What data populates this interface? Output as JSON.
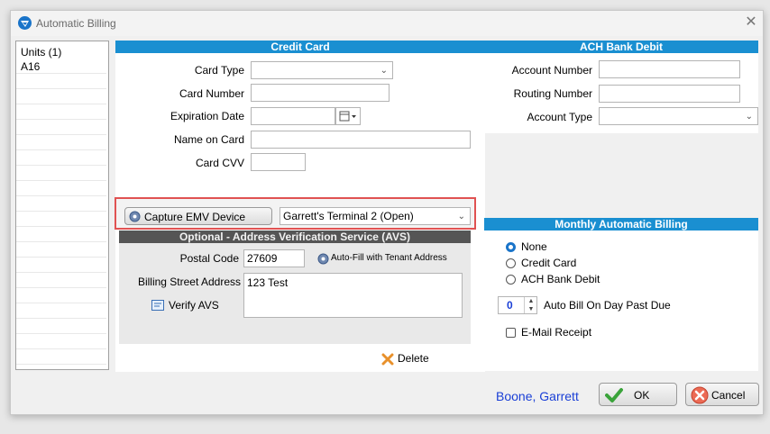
{
  "window": {
    "title": "Automatic Billing",
    "close_glyph": "✕"
  },
  "units": {
    "header": "Units (1)",
    "items": [
      "A16"
    ]
  },
  "credit_card": {
    "header": "Credit Card",
    "card_type_label": "Card Type",
    "card_type_value": "",
    "card_number_label": "Card Number",
    "card_number_value": "",
    "expiration_label": "Expiration Date",
    "expiration_value": "",
    "name_label": "Name on Card",
    "name_value": "",
    "cvv_label": "Card CVV",
    "cvv_value": ""
  },
  "emv": {
    "capture_button": "Capture EMV Device",
    "terminal_value": "Garrett's Terminal 2 (Open)"
  },
  "avs": {
    "header": "Optional - Address Verification Service (AVS)",
    "postal_label": "Postal Code",
    "postal_value": "27609",
    "autofill_button": "Auto-Fill with Tenant Address",
    "street_label": "Billing Street Address",
    "street_value": "123 Test",
    "verify_button": "Verify AVS",
    "delete_button": "Delete"
  },
  "ach": {
    "header": "ACH Bank Debit",
    "account_number_label": "Account Number",
    "account_number_value": "",
    "routing_label": "Routing Number",
    "routing_value": "",
    "account_type_label": "Account Type",
    "account_type_value": ""
  },
  "monthly": {
    "header": "Monthly Automatic Billing",
    "options": [
      "None",
      "Credit Card",
      "ACH Bank Debit"
    ],
    "selected": "None",
    "day_value": "0",
    "day_label": "Auto Bill On Day Past Due",
    "email_label": "E-Mail Receipt"
  },
  "footer": {
    "user_name": "Boone, Garrett",
    "ok_button": "OK",
    "cancel_button": "Cancel"
  },
  "colors": {
    "header_blue": "#1a8fd1",
    "highlight_red": "#e05252",
    "user_blue": "#1a3fd6"
  }
}
